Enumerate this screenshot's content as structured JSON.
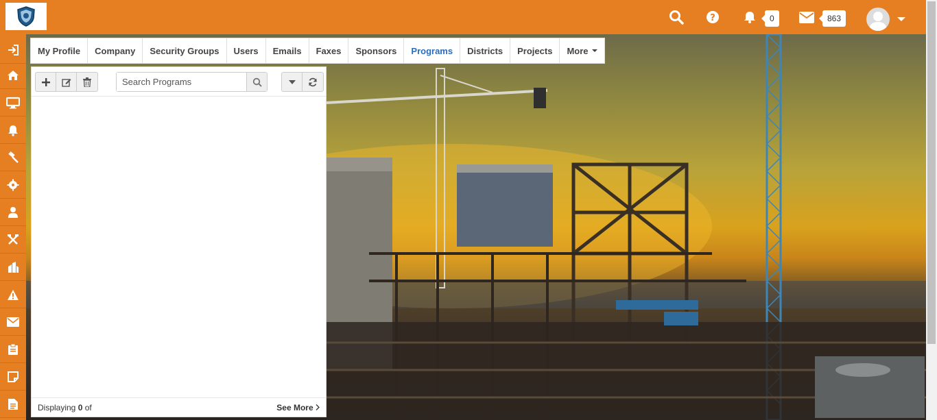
{
  "header": {
    "logo_icon": "shield-logo",
    "icons": [
      "search-icon",
      "help-icon",
      "bell-icon",
      "envelope-icon",
      "user-avatar"
    ],
    "notifications_count": "0",
    "messages_count": "863"
  },
  "sidebar": {
    "items": [
      {
        "icon": "sign-in-icon"
      },
      {
        "icon": "home-icon"
      },
      {
        "icon": "monitor-icon"
      },
      {
        "icon": "bell-icon"
      },
      {
        "icon": "gavel-icon"
      },
      {
        "icon": "gear-icon"
      },
      {
        "icon": "user-icon"
      },
      {
        "icon": "tools-icon"
      },
      {
        "icon": "building-icon"
      },
      {
        "icon": "warning-icon"
      },
      {
        "icon": "mail-icon"
      },
      {
        "icon": "clipboard-icon"
      },
      {
        "icon": "note-icon"
      },
      {
        "icon": "document-icon"
      }
    ]
  },
  "tabs": [
    {
      "label": "My Profile"
    },
    {
      "label": "Company"
    },
    {
      "label": "Security Groups"
    },
    {
      "label": "Users"
    },
    {
      "label": "Emails"
    },
    {
      "label": "Faxes"
    },
    {
      "label": "Sponsors"
    },
    {
      "label": "Programs",
      "active": true
    },
    {
      "label": "Districts"
    },
    {
      "label": "Projects"
    },
    {
      "label": "More"
    }
  ],
  "panel": {
    "search_placeholder": "Search Programs",
    "footer_prefix": "Displaying ",
    "footer_count": "0",
    "footer_suffix": " of",
    "see_more_label": "See More"
  },
  "colors": {
    "brand": "#e67e22",
    "active_tab": "#2a6ebb"
  }
}
